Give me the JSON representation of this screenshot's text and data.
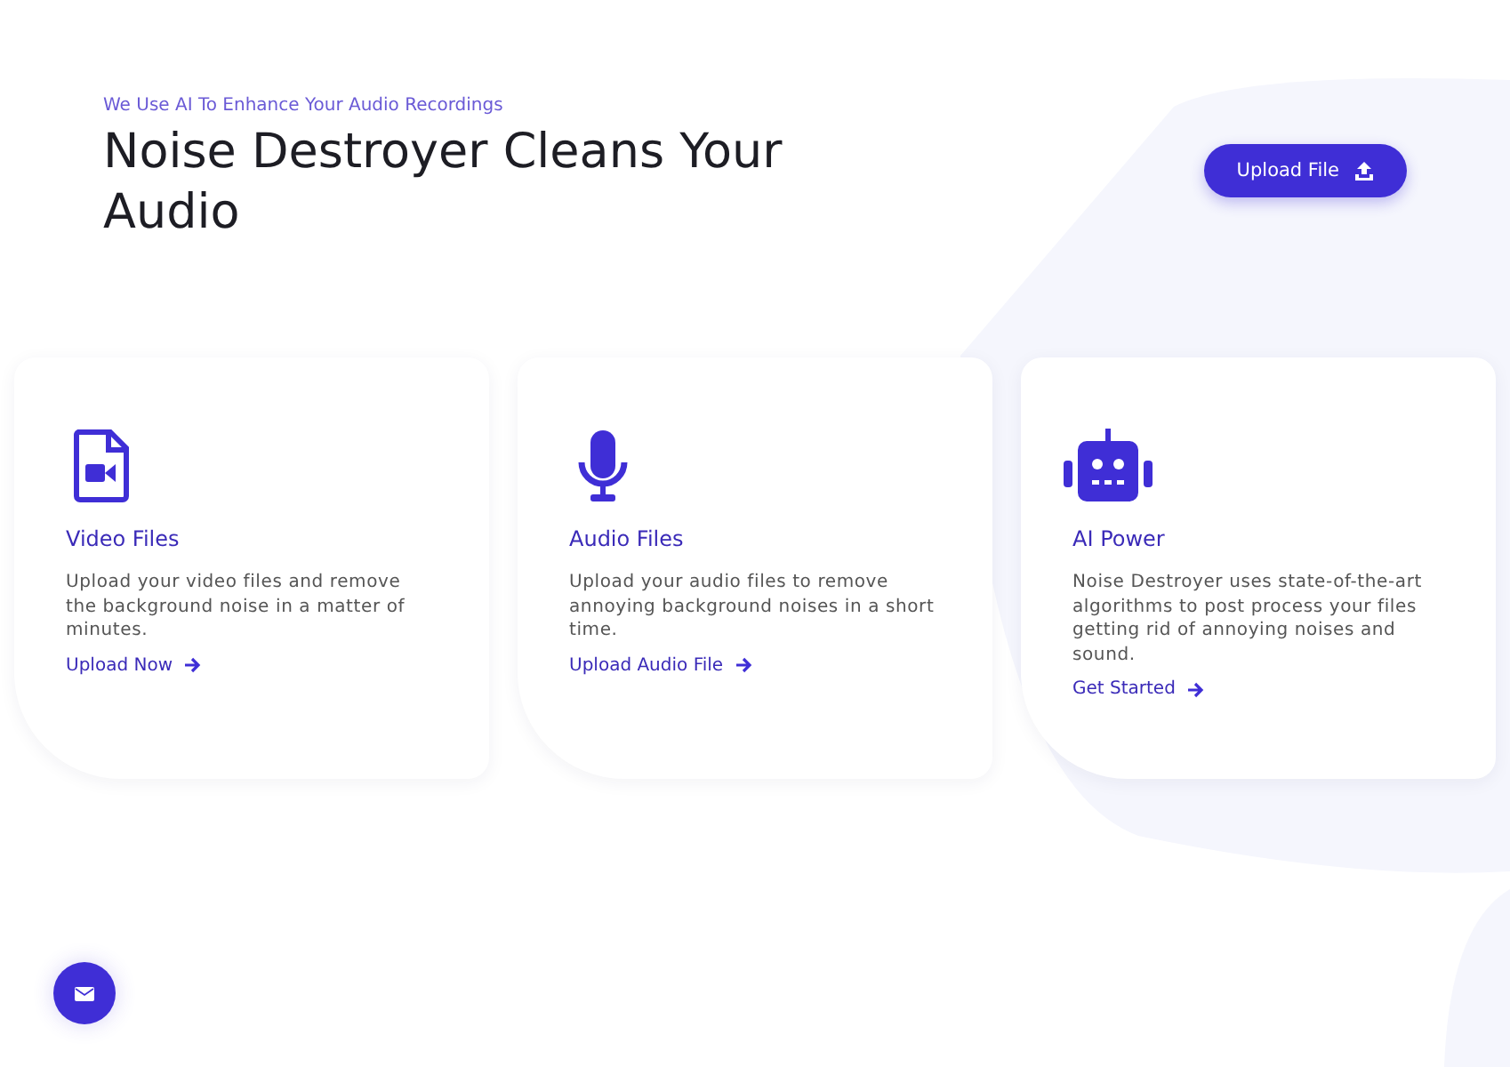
{
  "hero": {
    "eyebrow": "We Use AI To Enhance Your Audio Recordings",
    "title": "Noise Destroyer Cleans Your Audio",
    "button": "Upload File"
  },
  "cards": [
    {
      "kind": "video",
      "title": "Video Files",
      "text": "Upload your video files and remove the background noise in a matter of minutes.",
      "link": "Upload Now"
    },
    {
      "kind": "audio",
      "title": "Audio Files",
      "text": "Upload your audio files to remove annoying background noises in a short time.",
      "link": "Upload Audio File"
    },
    {
      "kind": "robot",
      "title": "AI Power",
      "text": "Noise Destroyer uses state-of-the-art algorithms to post process your files getting rid of annoying noises and sound.",
      "link": "Get Started"
    }
  ]
}
